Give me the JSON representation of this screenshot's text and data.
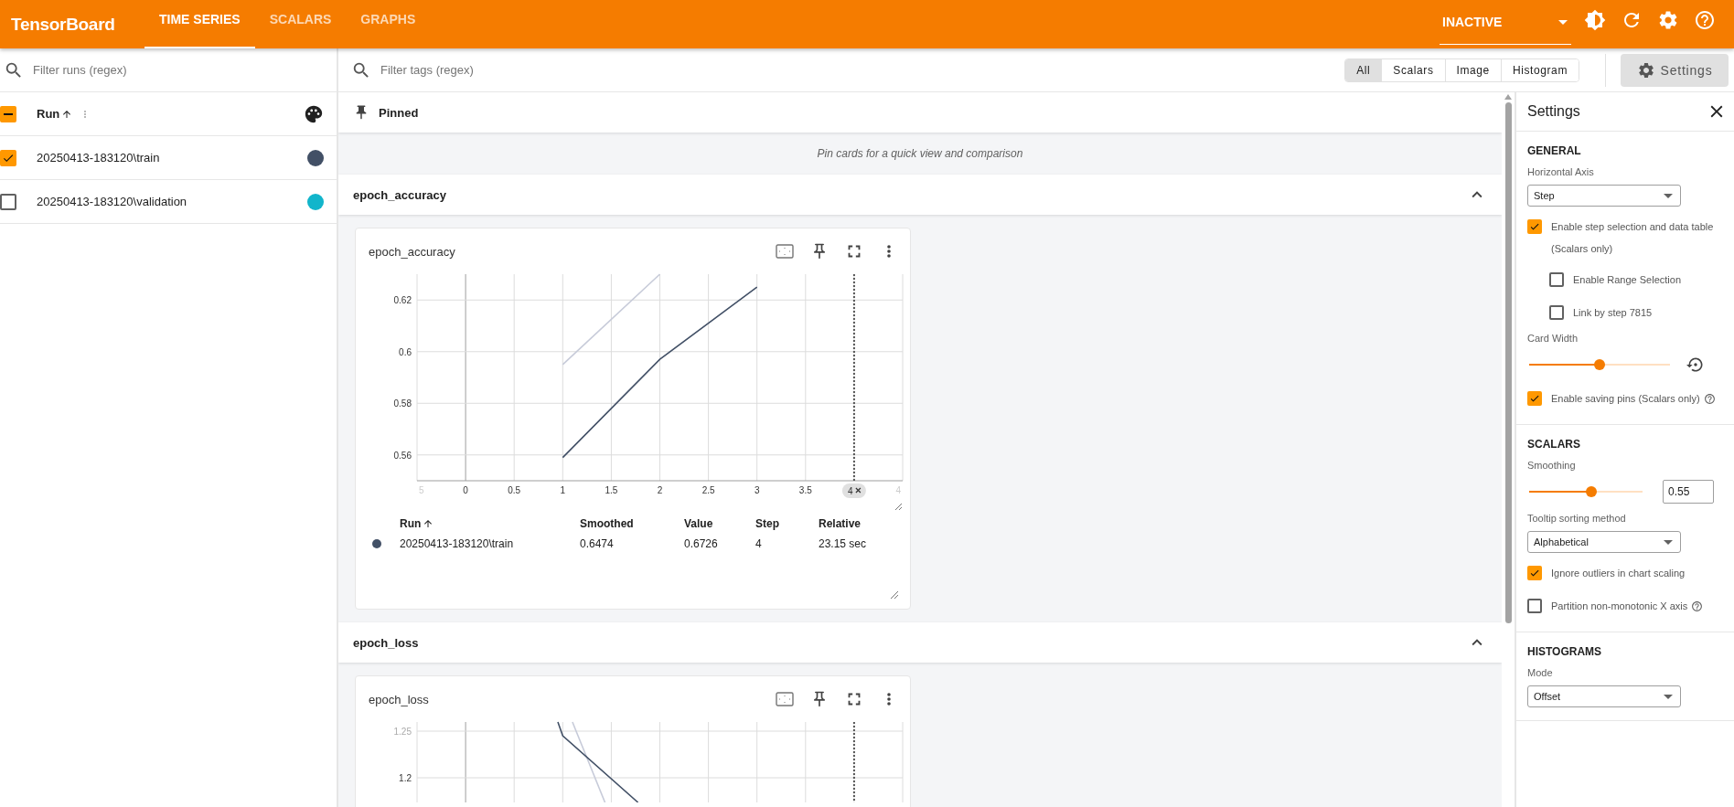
{
  "app": {
    "title": "TensorBoard",
    "tabs": [
      {
        "label": "TIME SERIES",
        "selected": true
      },
      {
        "label": "SCALARS",
        "selected": false
      },
      {
        "label": "GRAPHS",
        "selected": false
      }
    ],
    "status": "INACTIVE"
  },
  "runs_panel": {
    "filter_placeholder": "Filter runs (regex)",
    "header": "Run",
    "all_partial": true,
    "runs": [
      {
        "name": "20250413-183120\\train",
        "checked": true,
        "color": "#425066"
      },
      {
        "name": "20250413-183120\\validation",
        "checked": false,
        "color": "#12b5cb"
      }
    ]
  },
  "tags_bar": {
    "placeholder": "Filter tags (regex)",
    "filters": [
      {
        "label": "All",
        "selected": true
      },
      {
        "label": "Scalars",
        "selected": false
      },
      {
        "label": "Image",
        "selected": false
      },
      {
        "label": "Histogram",
        "selected": false
      }
    ],
    "settings_button": "Settings"
  },
  "pinned": {
    "title": "Pinned",
    "message": "Pin cards for a quick view and comparison"
  },
  "groups": [
    {
      "title": "epoch_accuracy",
      "expanded": true,
      "card": {
        "title": "epoch_accuracy",
        "kind": "chart",
        "edge_labels": [
          "5",
          "4"
        ],
        "chart_data": {
          "type": "line",
          "grid": true,
          "x": [
            1,
            2,
            3
          ],
          "xlim": [
            -0.5,
            4.5
          ],
          "ylim": [
            0.55,
            0.63
          ],
          "xticks": [
            0,
            0.5,
            1,
            1.5,
            2,
            2.5,
            3,
            3.5
          ],
          "yticks": [
            0.56,
            0.58,
            0.6,
            0.62
          ],
          "series": [
            {
              "color": "#c7cbd9",
              "values": [
                0.595,
                0.63,
                null
              ]
            },
            {
              "color": "#425066",
              "values": [
                0.559,
                0.597,
                0.625
              ]
            }
          ],
          "ref_lines": [
            {
              "axis": "x",
              "value": 4,
              "label": "4"
            }
          ]
        },
        "table": {
          "columns": [
            "Run",
            "Smoothed",
            "Value",
            "Step",
            "Relative"
          ],
          "rows": [
            {
              "color": "#425066",
              "cells": [
                "20250413-183120\\train",
                "0.6474",
                "0.6726",
                "4",
                "23.15 sec"
              ]
            }
          ]
        }
      }
    },
    {
      "title": "epoch_loss",
      "expanded": true,
      "card": {
        "title": "epoch_loss",
        "kind": "picture",
        "y_labels": [
          "1.25",
          "1.2"
        ]
      }
    }
  ],
  "settings": {
    "title": "Settings",
    "sections": [
      {
        "title": "GENERAL",
        "items": [
          {
            "kind": "select",
            "label": "Horizontal Axis",
            "value": "Step"
          },
          {
            "kind": "checkbox",
            "label": "Enable step selection and data table",
            "note": "(Scalars only)",
            "checked": true,
            "children": [
              {
                "kind": "checkbox",
                "label": "Enable Range Selection",
                "checked": false
              },
              {
                "kind": "checkbox",
                "label": "Link by step 7815",
                "checked": false
              }
            ]
          },
          {
            "kind": "slider",
            "label": "Card Width",
            "level": 0.5
          },
          {
            "kind": "checkbox",
            "label": "Enable saving pins (Scalars only)",
            "checked": true,
            "help": true
          }
        ]
      },
      {
        "title": "SCALARS",
        "items": [
          {
            "kind": "slider",
            "label": "Smoothing",
            "level": 0.55,
            "value": "0.55"
          },
          {
            "kind": "select",
            "label": "Tooltip sorting method",
            "value": "Alphabetical"
          },
          {
            "kind": "checkbox",
            "label": "Ignore outliers in chart scaling",
            "checked": true
          },
          {
            "kind": "checkbox",
            "label": "Partition non-monotonic X axis",
            "checked": false,
            "help": true
          }
        ]
      },
      {
        "title": "HISTOGRAMS",
        "items": [
          {
            "kind": "select",
            "label": "Mode",
            "value": "Offset"
          }
        ]
      }
    ]
  }
}
